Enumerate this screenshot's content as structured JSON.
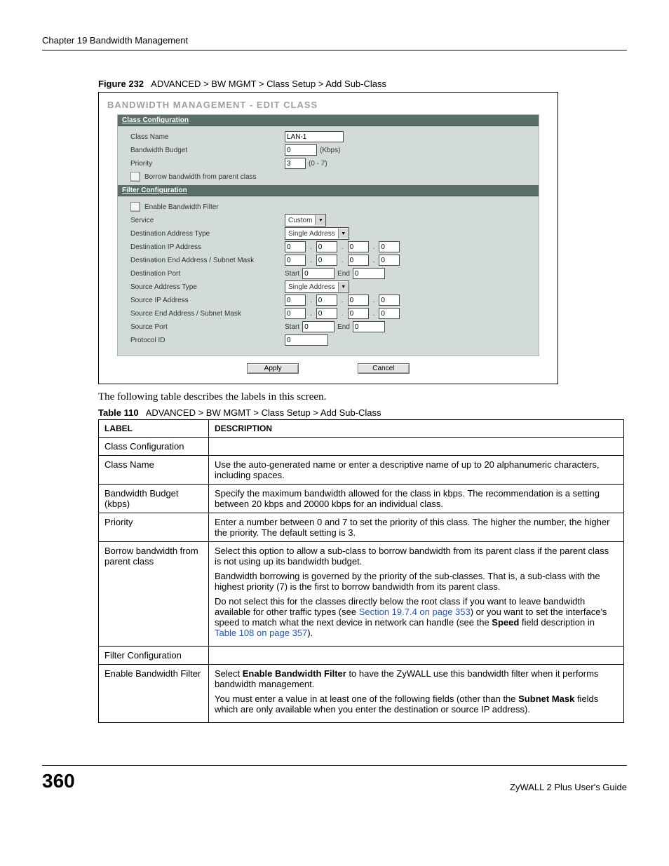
{
  "header": {
    "chapter": "Chapter 19 Bandwidth Management"
  },
  "figure": {
    "label": "Figure 232",
    "caption": "ADVANCED > BW MGMT > Class Setup > Add Sub-Class"
  },
  "ss": {
    "title": "BANDWIDTH MANAGEMENT - EDIT CLASS",
    "sect1": {
      "title": "Class Configuration",
      "class_name_label": "Class Name",
      "class_name_value": "LAN-1",
      "bw_budget_label": "Bandwidth Budget",
      "bw_budget_value": "0",
      "bw_budget_unit": "(Kbps)",
      "priority_label": "Priority",
      "priority_value": "3",
      "priority_range": "(0 - 7)",
      "borrow_label": "Borrow bandwidth from parent class"
    },
    "sect2": {
      "title": "Filter Configuration",
      "enable_filter_label": "Enable Bandwidth Filter",
      "service_label": "Service",
      "service_value": "Custom",
      "dest_addr_type_label": "Destination Address Type",
      "dest_addr_type_value": "Single Address",
      "dest_ip_label": "Destination IP Address",
      "dest_end_label": "Destination End Address / Subnet Mask",
      "dest_port_label": "Destination Port",
      "src_addr_type_label": "Source Address Type",
      "src_addr_type_value": "Single Address",
      "src_ip_label": "Source IP Address",
      "src_end_label": "Source End Address / Subnet Mask",
      "src_port_label": "Source Port",
      "protocol_id_label": "Protocol ID",
      "ip": [
        "0",
        "0",
        "0",
        "0"
      ],
      "port_start_label": "Start",
      "port_end_label": "End",
      "port_value": "0",
      "protocol_id_value": "0"
    },
    "buttons": {
      "apply": "Apply",
      "cancel": "Cancel"
    }
  },
  "body_text": "The following table describes the labels in this screen.",
  "table": {
    "label": "Table 110",
    "caption": "ADVANCED > BW MGMT > Class Setup > Add Sub-Class",
    "head": {
      "c1": "LABEL",
      "c2": "DESCRIPTION"
    },
    "rows": [
      {
        "label": "Class Configuration",
        "desc": ""
      },
      {
        "label": "Class Name",
        "desc": "Use the auto-generated name or enter a descriptive name of up to 20 alphanumeric characters, including spaces."
      },
      {
        "label": "Bandwidth Budget (kbps)",
        "desc": "Specify the maximum bandwidth allowed for the class in kbps. The recommendation is a setting between 20 kbps and 20000 kbps for an individual class."
      },
      {
        "label": "Priority",
        "desc": "Enter a number between 0 and 7 to set the priority of this class. The higher the number, the higher the priority. The default setting is 3."
      },
      {
        "label": "Borrow bandwidth from parent class",
        "desc_p1": "Select this option to allow a sub-class to borrow bandwidth from its parent class if the parent class is not using up its bandwidth budget.",
        "desc_p2": "Bandwidth borrowing is governed by the priority of the sub-classes. That is, a sub-class with the highest priority (7) is the first to borrow bandwidth from its parent class.",
        "desc_p3a": "Do not select this for the classes directly below the root class if you want to leave bandwidth available for other traffic types (see ",
        "desc_p3_link1": "Section 19.7.4 on page 353",
        "desc_p3b": ") or you want to set the interface's speed to match what the next device in network can handle (see the ",
        "desc_p3_bold": "Speed",
        "desc_p3c": " field description in ",
        "desc_p3_link2": "Table 108 on page 357",
        "desc_p3d": ")."
      },
      {
        "label": "Filter Configuration",
        "desc": ""
      },
      {
        "label": "Enable Bandwidth Filter",
        "desc_p1a": "Select ",
        "desc_p1_bold": "Enable Bandwidth Filter",
        "desc_p1b": " to have the ZyWALL use this bandwidth filter when it performs bandwidth management.",
        "desc_p2a": "You must enter a value in at least one of the following fields (other than the ",
        "desc_p2_bold": "Subnet Mask",
        "desc_p2b": " fields which are only available when you enter the destination or source IP address)."
      }
    ]
  },
  "footer": {
    "page": "360",
    "guide": "ZyWALL 2 Plus User's Guide"
  }
}
